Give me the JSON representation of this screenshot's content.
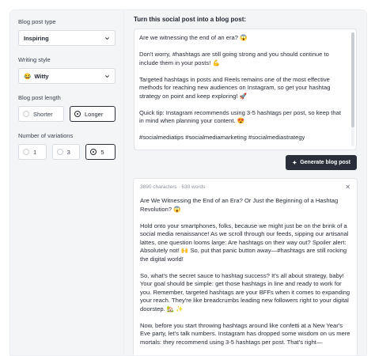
{
  "settings": {
    "post_type": {
      "label": "Blog post type",
      "value": "Inspiring"
    },
    "writing_style": {
      "label": "Writing style",
      "value": "Witty",
      "emoji": "😂"
    },
    "length": {
      "label": "Blog post length",
      "options": [
        {
          "label": "Shorter",
          "selected": false
        },
        {
          "label": "Longer",
          "selected": true
        }
      ]
    },
    "variations": {
      "label": "Number of variations",
      "options": [
        {
          "label": "1",
          "selected": false
        },
        {
          "label": "3",
          "selected": false
        },
        {
          "label": "5",
          "selected": true
        }
      ]
    }
  },
  "main": {
    "title": "Turn this social post into a blog post:",
    "post_paragraphs": [
      "Are we witnessing the end of an era? 😱",
      "Don't worry, #hashtags are still going strong and you should continue to include them in your posts! 💪",
      "Targeted hashtags in posts and Reels remains one of the most effective methods for reaching new audiences on Instagram, so get your hashtag strategy on point and keep exploring! 🚀",
      "Quick tip: Instagram recommends using 3-5 hashtags per post, so keep that in mind when planning your content. 😍",
      "#socialmediatips #socialmediamarketing #socialmediastrategy"
    ],
    "generate_label": "Generate blog post"
  },
  "result": {
    "meta": "3890 characters · 630 words",
    "paragraphs": [
      "Are We Witnessing the End of an Era? Or Just the Beginning of a Hashtag Revolution? 😱",
      "Hold onto your smartphones, folks, because we might just be on the brink of a social media renaissance! As we scroll through our feeds, sipping our artisanal lattes, one question looms large: Are hashtags on their way out? Spoiler alert: Absolutely not! 🙌 So, put that panic button away—#hashtags are still rocking the digital world!",
      "So, what's the secret sauce to hashtag success? It's all about strategy, baby! Your goal should be simple: get those hashtags in line and ready to work for you. Remember, targeted hashtags are your BFFs when it comes to expanding your reach. They're like breadcrumbs leading new followers right to your digital doorstep. 🏡 ✨",
      "Now, before you start throwing hashtags around like confetti at a New Year's Eve party, let's talk numbers. Instagram has dropped some wisdom on us mere mortals: they recommend using 3-5 hashtags per post. That's right—"
    ]
  }
}
